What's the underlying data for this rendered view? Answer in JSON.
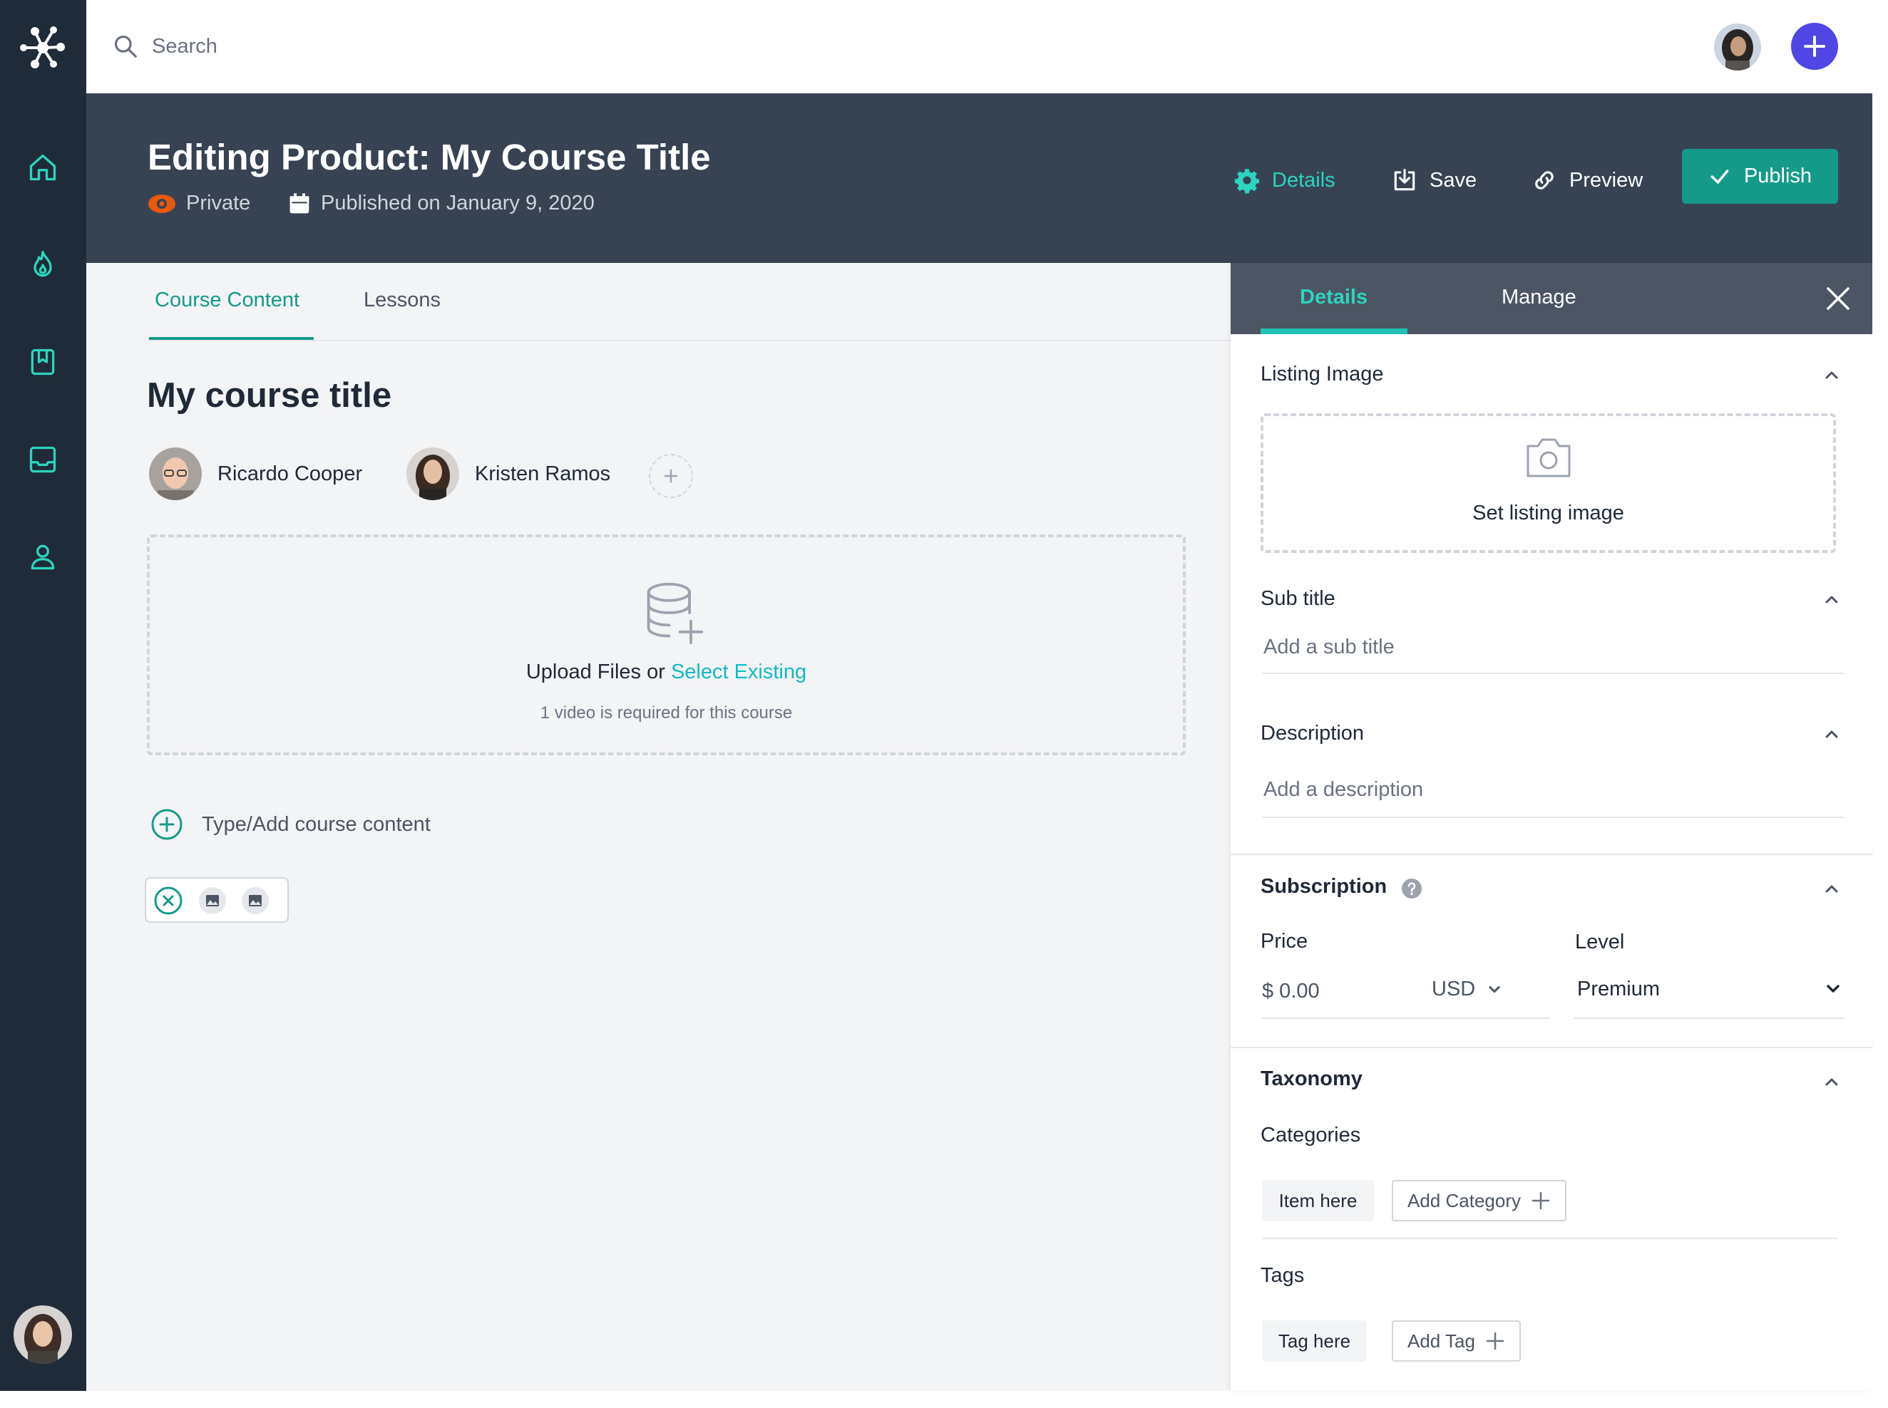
{
  "search": {
    "placeholder": "Search"
  },
  "header": {
    "title": "Editing Product: My Course Title",
    "visibility": "Private",
    "published": "Published on January 9, 2020",
    "details_label": "Details",
    "save_label": "Save",
    "preview_label": "Preview",
    "publish_label": "Publish"
  },
  "tabs": {
    "course_content": "Course Content",
    "lessons": "Lessons"
  },
  "course": {
    "title": "My course title",
    "authors": [
      {
        "name": "Ricardo Cooper"
      },
      {
        "name": "Kristen Ramos"
      }
    ]
  },
  "upload": {
    "text": "Upload Files or",
    "link": "Select Existing",
    "hint": "1 video is required for this course"
  },
  "add_content": {
    "label": "Type/Add course content"
  },
  "panel": {
    "tabs": {
      "details": "Details",
      "manage": "Manage"
    },
    "listing_image": {
      "title": "Listing Image",
      "action": "Set listing image"
    },
    "subtitle": {
      "title": "Sub title",
      "placeholder": "Add a sub title"
    },
    "description": {
      "title": "Description",
      "placeholder": "Add a description"
    },
    "subscription": {
      "title": "Subscription",
      "price_label": "Price",
      "price_value": "$ 0.00",
      "currency": "USD",
      "level_label": "Level",
      "level_value": "Premium"
    },
    "taxonomy": {
      "title": "Taxonomy",
      "categories_label": "Categories",
      "category_item": "Item here",
      "add_category": "Add Category",
      "tags_label": "Tags",
      "tag_item": "Tag here",
      "add_tag": "Add Tag"
    }
  },
  "colors": {
    "sidebar": "#1f2b38",
    "header": "#374353",
    "accent": "#159a8a",
    "teal_link": "#14b8c4",
    "add_button": "#4f46e5",
    "panel_head": "#4b5563"
  },
  "icons": [
    "logo-icon",
    "search-icon",
    "home-icon",
    "fire-icon",
    "bookmark-icon",
    "inbox-icon",
    "user-icon",
    "plus-icon",
    "eye-icon",
    "calendar-icon",
    "gear-icon",
    "save-icon",
    "link-icon",
    "check-icon",
    "database-plus-icon",
    "camera-icon",
    "chevron-up-icon",
    "chevron-down-icon",
    "close-icon",
    "help-icon",
    "image-icon"
  ]
}
